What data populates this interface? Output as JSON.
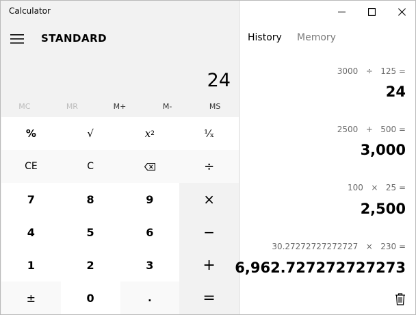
{
  "app": {
    "title": "Calculator",
    "mode": "STANDARD"
  },
  "display": {
    "value": "24"
  },
  "memory": [
    "MC",
    "MR",
    "M+",
    "M-",
    "MS"
  ],
  "keys": {
    "percent": "%",
    "sqrt": "√",
    "square_base": "x",
    "square_exp": "2",
    "reciprocal": "¹⁄ₓ",
    "ce": "CE",
    "c": "C",
    "backspace": "⌫",
    "divide": "÷",
    "n7": "7",
    "n8": "8",
    "n9": "9",
    "multiply": "×",
    "n4": "4",
    "n5": "5",
    "n6": "6",
    "minus": "−",
    "n1": "1",
    "n2": "2",
    "n3": "3",
    "plus": "+",
    "negate": "±",
    "n0": "0",
    "decimal": ".",
    "equals": "="
  },
  "panel": {
    "tab_history": "History",
    "tab_memory": "Memory",
    "entries": [
      {
        "expression": "3000   ÷   125 =",
        "result": "24"
      },
      {
        "expression": "2500   +   500 =",
        "result": "3,000"
      },
      {
        "expression": "100   ×   25 =",
        "result": "2,500"
      },
      {
        "expression": "30.27272727272727   ×   230 =",
        "result": "6,962.727272727273"
      }
    ]
  },
  "icons": {
    "minimize": "minimize-icon",
    "maximize": "maximize-icon",
    "close": "close-icon",
    "menu": "hamburger-icon",
    "trash": "trash-icon"
  }
}
